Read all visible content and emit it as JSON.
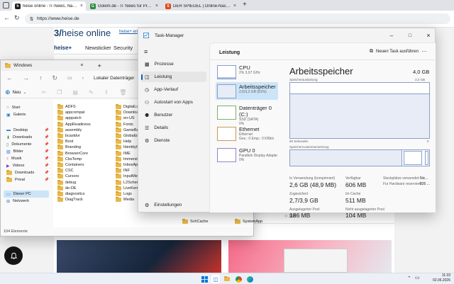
{
  "browser": {
    "tabs": [
      {
        "label": "heise online - IT-News, Nachrichte"
      },
      {
        "label": "Golem.de - IT News für Profis"
      },
      {
        "label": "DER SPIEGEL | Online-Nachrichten"
      }
    ],
    "url": "https://www.heise.de",
    "site": {
      "logo": "heise online",
      "heiseplus_link": "heise+ ent",
      "nav_brand": "heise+",
      "nav_items": [
        "Newsticker",
        "Security"
      ],
      "comment_count": "116"
    }
  },
  "taskmanager": {
    "title": "Task-Manager",
    "nav": [
      "Prozesse",
      "Leistung",
      "App-Verlauf",
      "Autostart von Apps",
      "Benutzer",
      "Details",
      "Dienste"
    ],
    "settings": "Einstellungen",
    "section": "Leistung",
    "new_task": "Neuen Task ausführen",
    "perf_items": [
      {
        "title": "CPU",
        "sub1": "2% 3,07 GHz",
        "sub2": "",
        "sub3": ""
      },
      {
        "title": "Arbeitsspeicher",
        "sub1": "2,6/3,2 GB (81%)",
        "sub2": "",
        "sub3": ""
      },
      {
        "title": "Datenträger 0 (C:)",
        "sub1": "SSD (SATA)",
        "sub2": "0%",
        "sub3": ""
      },
      {
        "title": "Ethernet",
        "sub1": "Ethernet",
        "sub2": "Ges.: 0 Emp.: 0 KBit/s",
        "sub3": ""
      },
      {
        "title": "GPU 0",
        "sub1": "Parallels Display Adapte",
        "sub2": "0%",
        "sub3": ""
      }
    ],
    "memory": {
      "heading": "Arbeitsspeicher",
      "total": "4,0 GB",
      "usage_label": "Speicherauslastung",
      "usage_max": "3,2 GB",
      "time_label": "60 Sekunden",
      "time_zero": "0",
      "composition_label": "Speicherzusammensetzung",
      "stats": [
        {
          "label": "In Verwendung (komprimiert)",
          "value": "2,6 GB (48,9 MB)"
        },
        {
          "label": "Verfügbar",
          "value": "606 MB"
        },
        {
          "label": "Zugesichert",
          "value": "2,7/3,9 GB"
        },
        {
          "label": "Im Cache",
          "value": "511 MB"
        },
        {
          "label": "Ausgelagerter Pool",
          "value": "186 MB"
        },
        {
          "label": "Nicht ausgelagerter Pool",
          "value": "104 MB"
        }
      ],
      "side_stats": [
        {
          "label": "Steckplätze verwendet:",
          "value": "Nic..."
        },
        {
          "label": "Für Hardware reserviert:",
          "value": "826 ..."
        }
      ],
      "usage_fraction": 0.81
    }
  },
  "explorer": {
    "title": "Windows",
    "new_label": "Neu",
    "breadcrumb": "Lokaler Datenträger",
    "tree": [
      {
        "label": "Start",
        "icon": "home-icon"
      },
      {
        "label": "Galerie",
        "icon": "gallery-icon"
      },
      {
        "label": "Desktop",
        "icon": "desktop-icon"
      },
      {
        "label": "Downloads",
        "icon": "download-icon"
      },
      {
        "label": "Dokumente",
        "icon": "document-icon"
      },
      {
        "label": "Bilder",
        "icon": "picture-icon"
      },
      {
        "label": "Musik",
        "icon": "music-icon"
      },
      {
        "label": "Videos",
        "icon": "video-icon"
      },
      {
        "label": "Downloads",
        "icon": "download-icon"
      },
      {
        "label": "Privat",
        "icon": "folder-icon"
      },
      {
        "label": "Dieser PC",
        "icon": "pc-icon"
      },
      {
        "label": "Netzwerk",
        "icon": "network-icon"
      }
    ],
    "col1": [
      "ADFS",
      "appcompat",
      "apppatch",
      "AppReadiness",
      "assembly",
      "bcastdvr",
      "Boot",
      "Branding",
      "BrowserCore",
      "CbsTemp",
      "Containers",
      "CSC",
      "Cursors",
      "debug",
      "de-DE",
      "diagnostics",
      "DiagTrack"
    ],
    "col2": [
      "DigitalLocke",
      "Downloade",
      "en-US",
      "Fonts",
      "GameBarPre",
      "Globalizatio",
      "Help",
      "IdentityCRL",
      "IME",
      "ImmersiveCo",
      "InboxApps",
      "INF",
      "InputMetho",
      "L2Schemas",
      "LiveKernelR",
      "Logs",
      "Media"
    ],
    "col3": [
      "SchCache"
    ],
    "col4": [
      "SystemApp"
    ],
    "status": "104 Elemente"
  },
  "taskbar": {
    "time": "11:33",
    "date": "02.06.2026"
  },
  "colors": {
    "accent": "#005fb8",
    "memory_graph": "#8aa0c8",
    "memory_fill": "#e7ecf7",
    "golem_green": "#2b8a3e",
    "spiegel_red": "#e64415"
  }
}
